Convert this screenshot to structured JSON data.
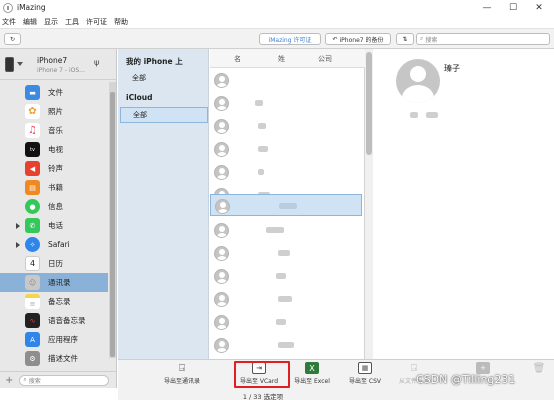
{
  "window": {
    "title": "iMazing",
    "minimize": "—",
    "maximize": "☐",
    "close": "✕"
  },
  "menu": [
    "文件",
    "编辑",
    "显示",
    "工具",
    "许可证",
    "帮助"
  ],
  "toolbar": {
    "license": "iMazing 许可证",
    "backup": "iPhone7 的备份",
    "search_placeholder": "搜索"
  },
  "device": {
    "name": "iPhone7",
    "subtitle": "iPhone 7 - iOS..."
  },
  "sidebar": {
    "items": [
      {
        "label": "文件",
        "icon": "folder-icon",
        "color": "#3d8be0"
      },
      {
        "label": "照片",
        "icon": "photos-icon",
        "color": "#f0a030"
      },
      {
        "label": "音乐",
        "icon": "music-icon",
        "color": "#f0405a"
      },
      {
        "label": "电视",
        "icon": "tv-icon",
        "color": "#111111"
      },
      {
        "label": "铃声",
        "icon": "ringtone-icon",
        "color": "#e8402c"
      },
      {
        "label": "书籍",
        "icon": "books-icon",
        "color": "#f08a20"
      },
      {
        "label": "信息",
        "icon": "messages-icon",
        "color": "#34c759"
      },
      {
        "label": "电话",
        "icon": "phone-icon",
        "color": "#34c759"
      },
      {
        "label": "Safari",
        "icon": "safari-icon",
        "color": "#2f86e8"
      },
      {
        "label": "日历",
        "icon": "calendar-icon",
        "color": "#ffffff"
      },
      {
        "label": "通讯录",
        "icon": "contacts-icon",
        "color": "#a0a0a0"
      },
      {
        "label": "备忘录",
        "icon": "notes-icon",
        "color": "#f5d54a"
      },
      {
        "label": "语音备忘录",
        "icon": "voice-memo-icon",
        "color": "#222222"
      },
      {
        "label": "应用程序",
        "icon": "apps-icon",
        "color": "#2f86e8"
      },
      {
        "label": "描述文件",
        "icon": "profiles-icon",
        "color": "#8e8e8e"
      }
    ],
    "search_placeholder": "搜索"
  },
  "groups": {
    "iphone_header": "我的 iPhone 上",
    "all1": "全部",
    "icloud_header": "iCloud",
    "all2": "全部"
  },
  "contacts": {
    "columns": [
      "名",
      "姓",
      "公司"
    ]
  },
  "detail": {
    "name": "瑧子"
  },
  "export": {
    "buttons": [
      "导出至通讯录",
      "导出至 VCard",
      "导出至 Excel",
      "导出至 CSV",
      "从文件导入",
      "",
      ""
    ],
    "status": "1 / 33 选定项"
  },
  "watermark": "CSDN @Tilling231"
}
